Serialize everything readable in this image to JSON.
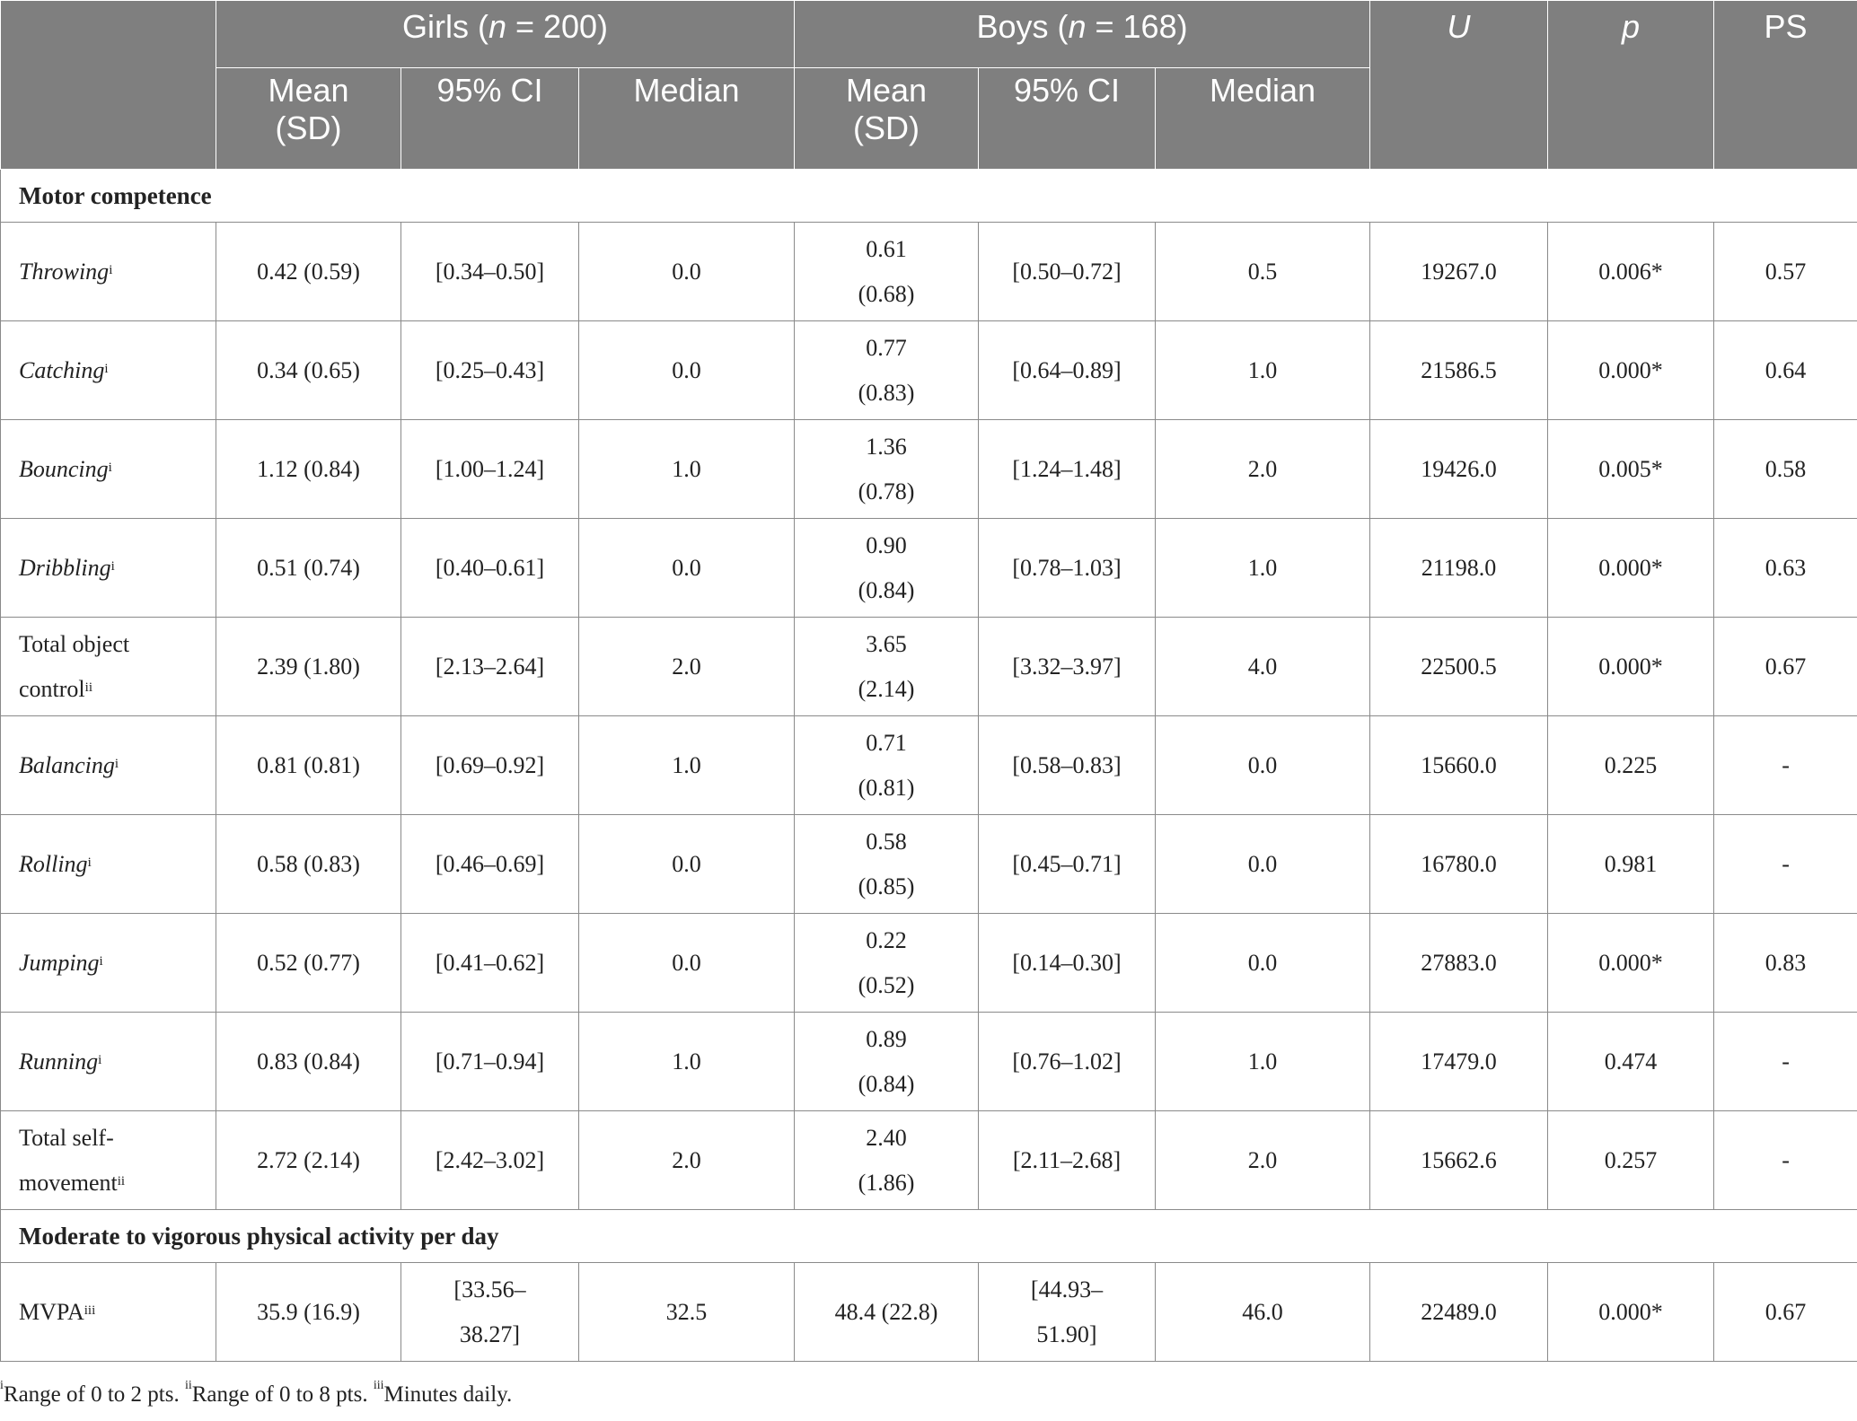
{
  "header": {
    "girls": {
      "prefix": "Girls (",
      "n": "n",
      "suffix": " = 200)"
    },
    "boys": {
      "prefix": "Boys (",
      "n": "n",
      "suffix": " = 168)"
    },
    "u": "U",
    "p": "p",
    "ps": "PS",
    "sub": {
      "mean_line1": "Mean",
      "mean_line2": "(SD)",
      "ci": "95% CI",
      "median": "Median"
    }
  },
  "sections": {
    "motor": "Motor competence",
    "mvpa": "Moderate to vigorous physical activity per day"
  },
  "rows": [
    {
      "label": "Throwing",
      "sup": "i",
      "italic": true,
      "g_mean": "0.42 (0.59)",
      "g_ci": "[0.34–0.50]",
      "g_med": "0.0",
      "b_mean1": "0.61",
      "b_mean2": "(0.68)",
      "b_ci": "[0.50–0.72]",
      "b_med": "0.5",
      "u": "19267.0",
      "p": "0.006*",
      "ps": "0.57"
    },
    {
      "label": "Catching",
      "sup": "i",
      "italic": true,
      "g_mean": "0.34 (0.65)",
      "g_ci": "[0.25–0.43]",
      "g_med": "0.0",
      "b_mean1": "0.77",
      "b_mean2": "(0.83)",
      "b_ci": "[0.64–0.89]",
      "b_med": "1.0",
      "u": "21586.5",
      "p": "0.000*",
      "ps": "0.64"
    },
    {
      "label": "Bouncing",
      "sup": "i",
      "italic": true,
      "g_mean": "1.12 (0.84)",
      "g_ci": "[1.00–1.24]",
      "g_med": "1.0",
      "b_mean1": "1.36",
      "b_mean2": "(0.78)",
      "b_ci": "[1.24–1.48]",
      "b_med": "2.0",
      "u": "19426.0",
      "p": "0.005*",
      "ps": "0.58"
    },
    {
      "label": "Dribbling",
      "sup": "i",
      "italic": true,
      "g_mean": "0.51 (0.74)",
      "g_ci": "[0.40–0.61]",
      "g_med": "0.0",
      "b_mean1": "0.90",
      "b_mean2": "(0.84)",
      "b_ci": "[0.78–1.03]",
      "b_med": "1.0",
      "u": "21198.0",
      "p": "0.000*",
      "ps": "0.63"
    },
    {
      "label1": "Total object",
      "label2": "control",
      "sup": "ii",
      "italic": false,
      "g_mean": "2.39 (1.80)",
      "g_ci": "[2.13–2.64]",
      "g_med": "2.0",
      "b_mean1": "3.65",
      "b_mean2": "(2.14)",
      "b_ci": "[3.32–3.97]",
      "b_med": "4.0",
      "u": "22500.5",
      "p": "0.000*",
      "ps": "0.67"
    },
    {
      "label": "Balancing",
      "sup": "i",
      "italic": true,
      "g_mean": "0.81 (0.81)",
      "g_ci": "[0.69–0.92]",
      "g_med": "1.0",
      "b_mean1": "0.71",
      "b_mean2": "(0.81)",
      "b_ci": "[0.58–0.83]",
      "b_med": "0.0",
      "u": "15660.0",
      "p": "0.225",
      "ps": "-"
    },
    {
      "label": "Rolling",
      "sup": "i",
      "italic": true,
      "g_mean": "0.58 (0.83)",
      "g_ci": "[0.46–0.69]",
      "g_med": "0.0",
      "b_mean1": "0.58",
      "b_mean2": "(0.85)",
      "b_ci": "[0.45–0.71]",
      "b_med": "0.0",
      "u": "16780.0",
      "p": "0.981",
      "ps": "-"
    },
    {
      "label": "Jumping",
      "sup": "i",
      "italic": true,
      "g_mean": "0.52 (0.77)",
      "g_ci": "[0.41–0.62]",
      "g_med": "0.0",
      "b_mean1": "0.22",
      "b_mean2": "(0.52)",
      "b_ci": "[0.14–0.30]",
      "b_med": "0.0",
      "u": "27883.0",
      "p": "0.000*",
      "ps": "0.83"
    },
    {
      "label": "Running",
      "sup": "i",
      "italic": true,
      "g_mean": "0.83 (0.84)",
      "g_ci": "[0.71–0.94]",
      "g_med": "1.0",
      "b_mean1": "0.89",
      "b_mean2": "(0.84)",
      "b_ci": "[0.76–1.02]",
      "b_med": "1.0",
      "u": "17479.0",
      "p": "0.474",
      "ps": "-"
    },
    {
      "label1": "Total self-",
      "label2": "movement",
      "sup": "ii",
      "italic": false,
      "g_mean": "2.72 (2.14)",
      "g_ci": "[2.42–3.02]",
      "g_med": "2.0",
      "b_mean1": "2.40",
      "b_mean2": "(1.86)",
      "b_ci": "[2.11–2.68]",
      "b_med": "2.0",
      "u": "15662.6",
      "p": "0.257",
      "ps": "-"
    }
  ],
  "mvpa_row": {
    "label": "MVPA",
    "sup": "iii",
    "g_mean": "35.9 (16.9)",
    "g_ci1": "[33.56–",
    "g_ci2": "38.27]",
    "g_med": "32.5",
    "b_mean": "48.4 (22.8)",
    "b_ci1": "[44.93–",
    "b_ci2": "51.90]",
    "b_med": "46.0",
    "u": "22489.0",
    "p": "0.000*",
    "ps": "0.67"
  },
  "footnote": {
    "s1": "i",
    "t1": "Range of 0 to 2 pts. ",
    "s2": "ii",
    "t2": "Range of 0 to 8 pts. ",
    "s3": "iii",
    "t3": "Minutes daily."
  }
}
